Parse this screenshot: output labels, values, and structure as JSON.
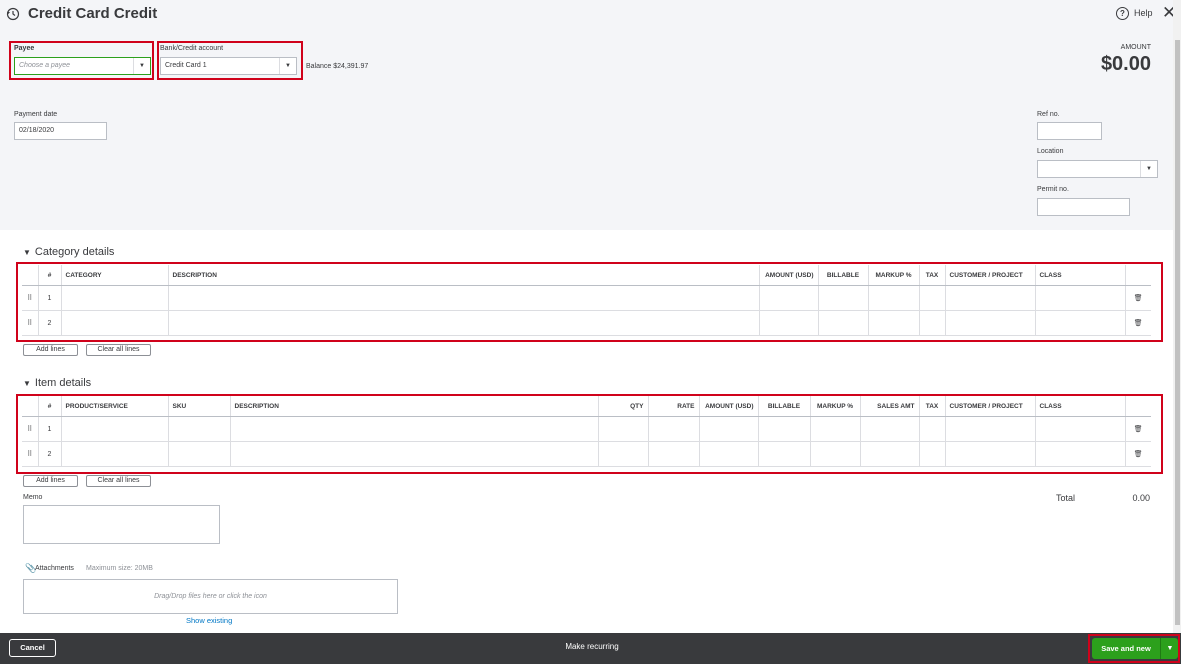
{
  "header": {
    "title": "Credit Card Credit",
    "help_label": "Help",
    "close_symbol": "✕",
    "history_icon": "history-icon"
  },
  "payee": {
    "label": "Payee",
    "placeholder": "Choose a payee"
  },
  "bank_account": {
    "label": "Bank/Credit account",
    "value": "Credit Card 1",
    "balance": "Balance $24,391.97"
  },
  "amount": {
    "label": "AMOUNT",
    "value": "$0.00"
  },
  "payment_date": {
    "label": "Payment date",
    "value": "02/18/2020"
  },
  "ref_no": {
    "label": "Ref no.",
    "value": ""
  },
  "location": {
    "label": "Location",
    "value": ""
  },
  "permit_no": {
    "label": "Permit no.",
    "value": ""
  },
  "category_details": {
    "title": "Category details",
    "columns": [
      "#",
      "CATEGORY",
      "DESCRIPTION",
      "AMOUNT (USD)",
      "BILLABLE",
      "MARKUP %",
      "TAX",
      "CUSTOMER / PROJECT",
      "CLASS"
    ],
    "rows": [
      "1",
      "2"
    ],
    "add_lines": "Add lines",
    "clear_lines": "Clear all lines"
  },
  "item_details": {
    "title": "Item details",
    "columns": [
      "#",
      "PRODUCT/SERVICE",
      "SKU",
      "DESCRIPTION",
      "QTY",
      "RATE",
      "AMOUNT (USD)",
      "BILLABLE",
      "MARKUP %",
      "SALES AMT",
      "TAX",
      "CUSTOMER / PROJECT",
      "CLASS"
    ],
    "rows": [
      "1",
      "2"
    ],
    "add_lines": "Add lines",
    "clear_lines": "Clear all lines"
  },
  "memo": {
    "label": "Memo",
    "value": ""
  },
  "total": {
    "label": "Total",
    "value": "0.00"
  },
  "attachments": {
    "label": "Attachments",
    "max_size": "Maximum size: 20MB",
    "drop_hint": "Drag/Drop files here or click the icon",
    "show_existing": "Show existing"
  },
  "footer": {
    "cancel": "Cancel",
    "make_recurring": "Make recurring",
    "save_and_new": "Save and new"
  },
  "colors": {
    "accent_green": "#2ca01c",
    "highlight_red": "#d0021b",
    "footer_bg": "#393a3d",
    "link_blue": "#0077c5"
  }
}
